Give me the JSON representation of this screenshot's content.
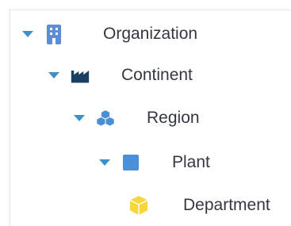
{
  "tree": {
    "nodes": [
      {
        "label": "Organization",
        "icon": "building-icon",
        "expanded": true
      },
      {
        "label": "Continent",
        "icon": "factory-icon",
        "expanded": true
      },
      {
        "label": "Region",
        "icon": "cubes-icon",
        "expanded": true
      },
      {
        "label": "Plant",
        "icon": "square-icon",
        "expanded": true
      },
      {
        "label": "Department",
        "icon": "cube-icon",
        "expanded": false
      }
    ]
  },
  "colors": {
    "caret": "#3f8fc9",
    "building": "#5b8ed6",
    "factory": "#1b3f63",
    "cubes": "#4a8fd6",
    "square": "#4a90d9",
    "cube": "#f6d63a",
    "text": "#333840"
  }
}
